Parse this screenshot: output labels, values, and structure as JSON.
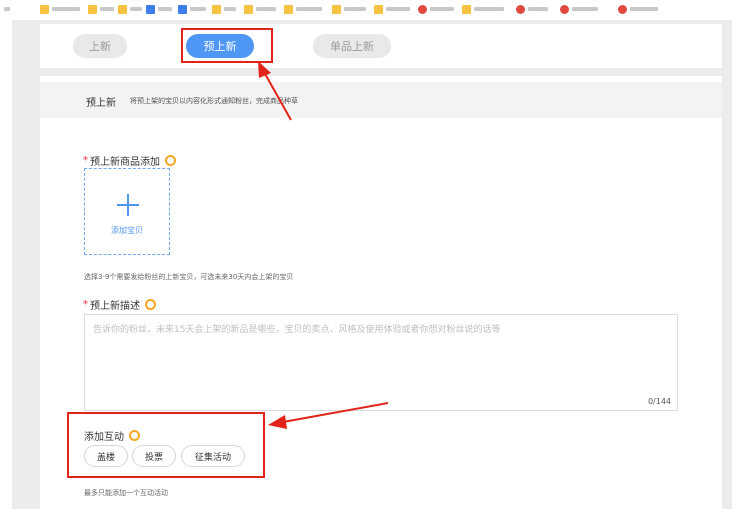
{
  "tabs": [
    {
      "label": "上新",
      "active": false
    },
    {
      "label": "预上新",
      "active": true
    },
    {
      "label": "单品上新",
      "active": false
    }
  ],
  "info": {
    "title": "预上新",
    "description": "将预上架的宝贝以内容化形式通知粉丝，完成商品种草"
  },
  "product_section": {
    "label": "预上新商品添加",
    "required_mark": "*",
    "upload_label": "添加宝贝",
    "tip": "选择3-9个需要发给粉丝的上新宝贝，可选未来30天内会上架的宝贝"
  },
  "description_section": {
    "label": "预上新描述",
    "required_mark": "*",
    "placeholder": "告诉你的粉丝，未来15天会上架的新品是哪些，宝贝的卖点、风格及使用体验或者你想对粉丝说的话等",
    "counter": "0/144"
  },
  "interaction_section": {
    "label": "添加互动",
    "options": [
      "盖楼",
      "投票",
      "征集活动"
    ],
    "tip": "最多只能添加一个互动活动"
  },
  "colors": {
    "accent": "#4f97f5",
    "annotation": "#e2231a",
    "hint": "#f5a623"
  }
}
